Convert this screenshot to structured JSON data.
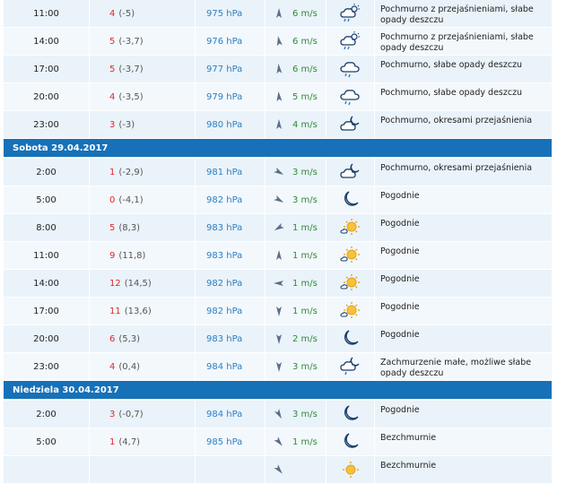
{
  "wind_unit": "m/s",
  "groups": [
    {
      "day": "",
      "rows": [
        {
          "time": "11:00",
          "temp": "4",
          "feel": "(-5)",
          "pressure": "975 hPa",
          "wind_speed": "6 m/s",
          "wind_dir_deg": 180,
          "icon": "cloud-rain-sun-icon",
          "desc": "Pochmurno z przejaśnieniami, słabe opady deszczu"
        },
        {
          "time": "14:00",
          "temp": "5",
          "feel": "(-3,7)",
          "pressure": "976 hPa",
          "wind_speed": "6 m/s",
          "wind_dir_deg": 170,
          "icon": "cloud-rain-sun-icon",
          "desc": "Pochmurno z przejaśnieniami, słabe opady deszczu"
        },
        {
          "time": "17:00",
          "temp": "5",
          "feel": "(-3,7)",
          "pressure": "977 hPa",
          "wind_speed": "6 m/s",
          "wind_dir_deg": 175,
          "icon": "cloud-rain-icon",
          "desc": "Pochmurno, słabe opady deszczu"
        },
        {
          "time": "20:00",
          "temp": "4",
          "feel": "(-3,5)",
          "pressure": "979 hPa",
          "wind_speed": "5 m/s",
          "wind_dir_deg": 175,
          "icon": "cloud-rain-icon",
          "desc": "Pochmurno, słabe opady deszczu"
        },
        {
          "time": "23:00",
          "temp": "3",
          "feel": "(-3)",
          "pressure": "980 hPa",
          "wind_speed": "4 m/s",
          "wind_dir_deg": 180,
          "icon": "cloud-moon-icon",
          "desc": "Pochmurno, okresami przejaśnienia"
        }
      ]
    },
    {
      "day": "Sobota 29.04.2017",
      "rows": [
        {
          "time": "2:00",
          "temp": "1",
          "feel": "(-2,9)",
          "pressure": "981 hPa",
          "wind_speed": "3 m/s",
          "wind_dir_deg": 300,
          "icon": "cloud-moon-icon",
          "desc": "Pochmurno, okresami przejaśnienia"
        },
        {
          "time": "5:00",
          "temp": "0",
          "feel": "(-4,1)",
          "pressure": "982 hPa",
          "wind_speed": "3 m/s",
          "wind_dir_deg": 300,
          "icon": "moon-icon",
          "desc": "Pogodnie"
        },
        {
          "time": "8:00",
          "temp": "5",
          "feel": "(8,3)",
          "pressure": "983 hPa",
          "wind_speed": "1 m/s",
          "wind_dir_deg": 60,
          "icon": "sun-cloud-icon",
          "desc": "Pogodnie"
        },
        {
          "time": "11:00",
          "temp": "9",
          "feel": "(11,8)",
          "pressure": "983 hPa",
          "wind_speed": "1 m/s",
          "wind_dir_deg": 180,
          "icon": "sun-cloud-icon",
          "desc": "Pogodnie"
        },
        {
          "time": "14:00",
          "temp": "12",
          "feel": "(14,5)",
          "pressure": "982 hPa",
          "wind_speed": "1 m/s",
          "wind_dir_deg": 90,
          "icon": "sun-cloud-icon",
          "desc": "Pogodnie"
        },
        {
          "time": "17:00",
          "temp": "11",
          "feel": "(13,6)",
          "pressure": "982 hPa",
          "wind_speed": "1 m/s",
          "wind_dir_deg": 0,
          "icon": "sun-cloud-icon",
          "desc": "Pogodnie"
        },
        {
          "time": "20:00",
          "temp": "6",
          "feel": "(5,3)",
          "pressure": "983 hPa",
          "wind_speed": "2 m/s",
          "wind_dir_deg": 0,
          "icon": "moon-icon",
          "desc": "Pogodnie"
        },
        {
          "time": "23:00",
          "temp": "4",
          "feel": "(0,4)",
          "pressure": "984 hPa",
          "wind_speed": "3 m/s",
          "wind_dir_deg": 0,
          "icon": "cloud-moon-rain-icon",
          "desc": "Zachmurzenie małe, możliwe słabe opady deszczu"
        }
      ]
    },
    {
      "day": "Niedziela 30.04.2017",
      "rows": [
        {
          "time": "2:00",
          "temp": "3",
          "feel": "(-0,7)",
          "pressure": "984 hPa",
          "wind_speed": "3 m/s",
          "wind_dir_deg": 330,
          "icon": "moon-icon",
          "desc": "Pogodnie"
        },
        {
          "time": "5:00",
          "temp": "1",
          "feel": "(4,7)",
          "pressure": "985 hPa",
          "wind_speed": "1 m/s",
          "wind_dir_deg": 320,
          "icon": "moon-icon",
          "desc": "Bezchmurnie"
        },
        {
          "time": "",
          "temp": "",
          "feel": "",
          "pressure": "",
          "wind_speed": "",
          "wind_dir_deg": 320,
          "icon": "sun-icon",
          "desc": "Bezchmurnie"
        }
      ]
    }
  ]
}
